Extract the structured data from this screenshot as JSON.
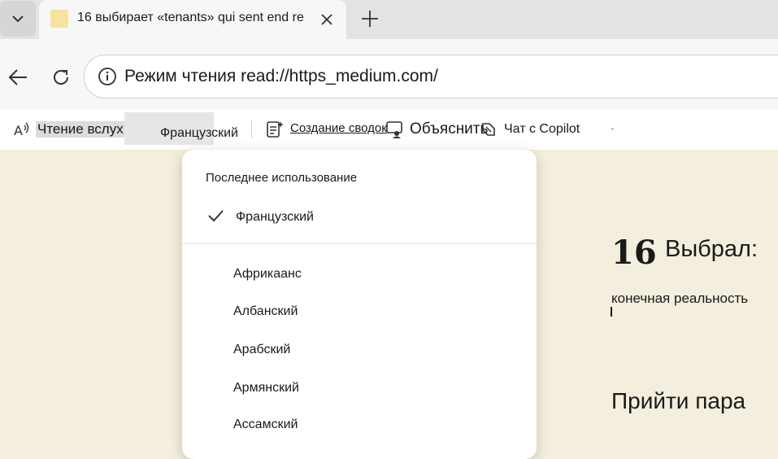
{
  "tab": {
    "title": "16 выбирает «tenants» qui sent end re"
  },
  "address": {
    "url": "Режим чтения read://https_medium.com/"
  },
  "reader_toolbar": {
    "read_aloud": "Чтение вслух ab",
    "language": "Французский",
    "summary": "Создание сводок",
    "explain": "Объяснить",
    "copilot": "Чат с Copilot"
  },
  "language_menu": {
    "header": "Последнее использование",
    "selected": "Французский",
    "options": [
      "Африкаанс",
      "Албанский",
      "Арабский",
      "Армянский",
      "Ассамский"
    ]
  },
  "article": {
    "number": "16",
    "title": "Выбрал:",
    "subtitle": "конечная реальность",
    "heading": "Прийти пара"
  },
  "icons": {
    "tab_list": "chevron-down-icon",
    "close": "close-icon",
    "new_tab": "plus-icon",
    "back": "back-arrow-icon",
    "reload": "reload-icon",
    "info": "info-icon",
    "read_aloud": "read-aloud-icon",
    "summary": "summary-icon",
    "explain": "explain-icon",
    "copilot": "copilot-icon",
    "check": "check-icon"
  }
}
